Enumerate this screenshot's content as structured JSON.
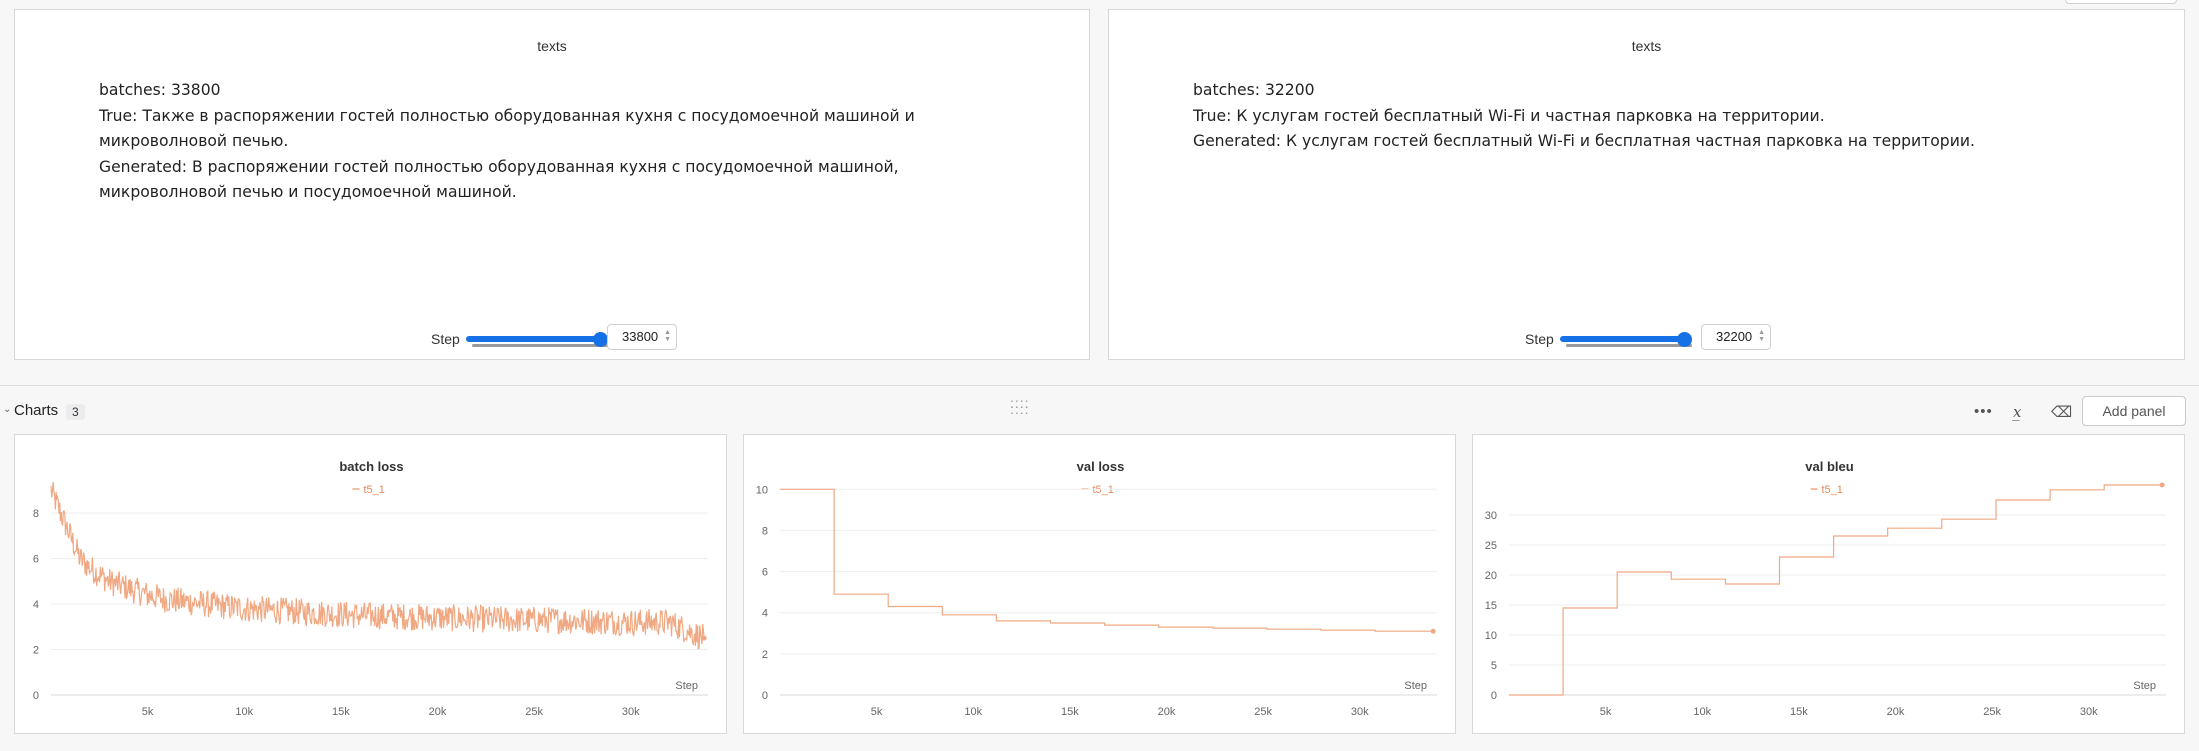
{
  "text_panels": [
    {
      "title": "texts",
      "batches": "batches: 33800",
      "true_text": "True: Также в распоряжении гостей полностью оборудованная кухня с посудомоечной машиной и микроволновой печью.",
      "generated_text": "Generated: В распоряжении гостей полностью оборудованная кухня с посудомоечной машиной, микроволновой печью и посудомоечной машиной.",
      "step_label": "Step",
      "step_value": "33800",
      "slider_fraction": 1.0
    },
    {
      "title": "texts",
      "batches": "batches: 32200",
      "true_text": "True: К услугам гостей бесплатный Wi-Fi и частная парковка на территории.",
      "generated_text": "Generated: К услугам гостей бесплатный Wi-Fi и бесплатная частная парковка на территории.",
      "step_label": "Step",
      "step_value": "32200",
      "slider_fraction": 1.0
    }
  ],
  "section": {
    "title": "Charts",
    "count": "3",
    "add_panel_label": "Add panel",
    "icons": [
      "chevron-down-icon",
      "drag-handle-icon",
      "more-icon",
      "x-axis-icon",
      "clear-icon"
    ]
  },
  "chart_data": [
    {
      "type": "line",
      "title": "batch loss",
      "series": [
        {
          "name": "t5_1",
          "color": "#f0a882",
          "x": [
            0,
            500,
            1000,
            1500,
            2000,
            3000,
            4000,
            5000,
            6000,
            8000,
            10000,
            12000,
            14000,
            16000,
            18000,
            20000,
            22000,
            24000,
            26000,
            28000,
            30000,
            32000,
            33800
          ],
          "y": [
            9.0,
            8.0,
            7.0,
            6.0,
            5.6,
            5.0,
            4.7,
            4.4,
            4.2,
            4.0,
            3.8,
            3.7,
            3.6,
            3.5,
            3.45,
            3.4,
            3.35,
            3.3,
            3.3,
            3.25,
            3.2,
            3.2,
            2.5
          ],
          "noise_amplitude": 0.6
        }
      ],
      "xlabel": "Step",
      "xlim": [
        0,
        34000
      ],
      "ylim": [
        0,
        9.5
      ],
      "xticks": [
        "5k",
        "10k",
        "15k",
        "20k",
        "25k",
        "30k"
      ],
      "yticks": [
        "0",
        "2",
        "4",
        "6",
        "8"
      ],
      "grid": true
    },
    {
      "type": "line",
      "title": "val loss",
      "series": [
        {
          "name": "t5_1",
          "color": "#f0a882",
          "x": [
            0,
            2800,
            2800,
            5600,
            5600,
            8400,
            8400,
            11200,
            11200,
            14000,
            14000,
            16800,
            16800,
            19600,
            19600,
            22400,
            22400,
            25200,
            25200,
            28000,
            28000,
            30800,
            30800,
            33800
          ],
          "y": [
            10,
            10,
            4.9,
            4.9,
            4.3,
            4.3,
            3.9,
            3.9,
            3.6,
            3.6,
            3.5,
            3.5,
            3.4,
            3.4,
            3.3,
            3.3,
            3.25,
            3.25,
            3.2,
            3.2,
            3.15,
            3.15,
            3.1,
            3.1
          ]
        }
      ],
      "xlabel": "Step",
      "xlim": [
        0,
        34000
      ],
      "ylim": [
        0,
        10.5
      ],
      "xticks": [
        "5k",
        "10k",
        "15k",
        "20k",
        "25k",
        "30k"
      ],
      "yticks": [
        "0",
        "2",
        "4",
        "6",
        "8",
        "10"
      ],
      "grid": true
    },
    {
      "type": "line",
      "title": "val bleu",
      "series": [
        {
          "name": "t5_1",
          "color": "#f0a882",
          "x": [
            0,
            2800,
            2800,
            5600,
            5600,
            8400,
            8400,
            11200,
            11200,
            14000,
            14000,
            16800,
            16800,
            19600,
            19600,
            22400,
            22400,
            25200,
            25200,
            28000,
            28000,
            30800,
            30800,
            33800
          ],
          "y": [
            0,
            0,
            14.5,
            14.5,
            20.5,
            20.5,
            19.3,
            19.3,
            18.5,
            18.5,
            23.0,
            23.0,
            26.5,
            26.5,
            27.8,
            27.8,
            29.3,
            29.3,
            32.5,
            32.5,
            34.2,
            34.2,
            35.0,
            35.0
          ]
        }
      ],
      "xlabel": "Step",
      "xlim": [
        0,
        34000
      ],
      "ylim": [
        0,
        36
      ],
      "xticks": [
        "5k",
        "10k",
        "15k",
        "20k",
        "25k",
        "30k"
      ],
      "yticks": [
        "0",
        "5",
        "10",
        "15",
        "20",
        "25",
        "30"
      ],
      "grid": true
    }
  ]
}
